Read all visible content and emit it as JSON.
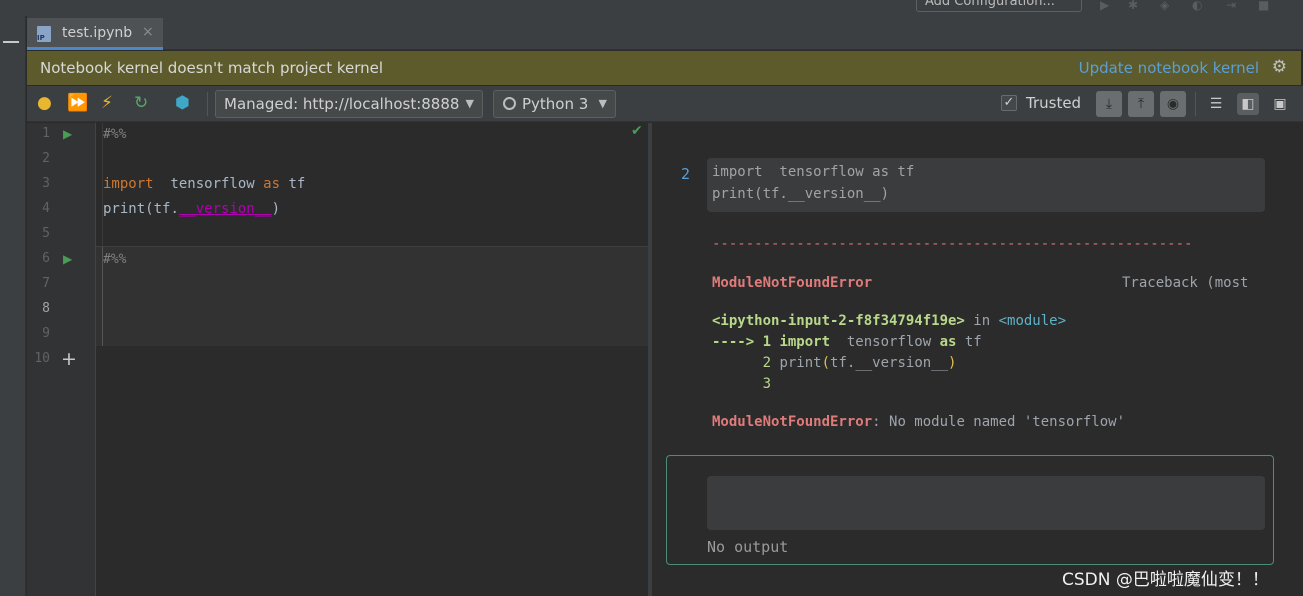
{
  "window": {
    "run_config_label": "Add Configuration..."
  },
  "tab": {
    "file_icon_text": "IP",
    "label": "test.ipynb",
    "close_glyph": "×"
  },
  "banner": {
    "message": "Notebook kernel doesn't match project kernel",
    "link": "Update notebook kernel",
    "background_color": "#5d5b2b"
  },
  "toolbar": {
    "server_label": "Managed: http://localhost:8888",
    "kernel_label": "Python 3",
    "trusted_label": "Trusted",
    "trusted_checked": true,
    "icons": [
      "lightbulb-icon",
      "run-all-icon",
      "lightning-icon",
      "restart-icon",
      "interpreter-icon",
      "collapse-output-icon",
      "expand-output-icon",
      "eye-icon",
      "editor-only-icon",
      "split-view-icon",
      "preview-only-icon"
    ]
  },
  "editor": {
    "line_numbers": [
      "1",
      "2",
      "3",
      "4",
      "5",
      "6",
      "7",
      "8",
      "9",
      "10"
    ],
    "current_line": "8",
    "cell1_marker": "#%%",
    "cell2_marker": "#%%",
    "code": {
      "kw_import": "import",
      "module": "  tensorflow",
      "kw_as": " as",
      "alias": " tf",
      "print": "print",
      "open": "(tf.",
      "dunder": "__version__",
      "close": ")"
    }
  },
  "preview": {
    "exec_count": "2",
    "input_lines": [
      "import  tensorflow as tf",
      "print(tf.__version__)"
    ],
    "dash_line": "---------------------------------------------------------",
    "error_name": "ModuleNotFoundError",
    "traceback_label": "Traceback (most",
    "tb_input": "<ipython-input-2-f8f34794f19e>",
    "tb_in": " in ",
    "tb_module": "<module>",
    "tb_arrow": "----> 1 ",
    "tb_import": "import",
    "tb_module_name": "  tensorflow ",
    "tb_as": "as",
    "tb_alias": " tf",
    "tb_line2_num": "      2 ",
    "tb_line2_print": "print",
    "tb_line2_paren_open": "(",
    "tb_line2_args": "tf.__version__",
    "tb_line2_paren_close": ")",
    "tb_line3": "      3",
    "final_error_name": "ModuleNotFoundError",
    "final_error_msg": ": No module named 'tensorflow'",
    "no_output": "No output"
  },
  "watermark": "CSDN @巴啦啦魔仙变！！"
}
